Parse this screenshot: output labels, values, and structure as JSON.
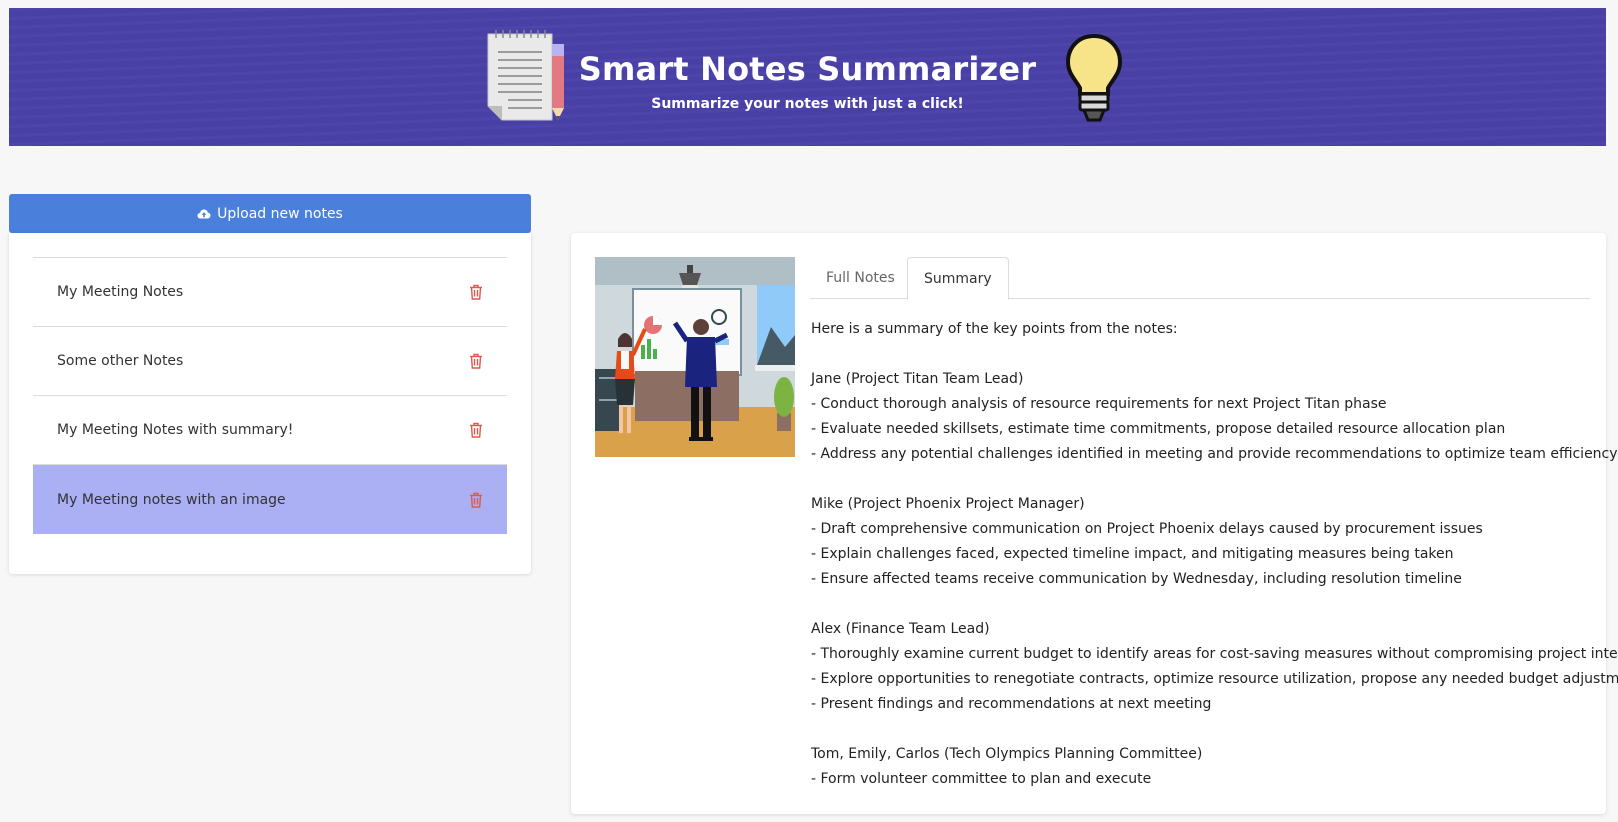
{
  "header": {
    "title": "Smart Notes Summarizer",
    "subtitle": "Summarize your notes with just a click!",
    "colors": {
      "background": "#4a41a8"
    }
  },
  "sidebar": {
    "upload_label": "Upload new notes",
    "upload_icon": "cloud-upload-icon",
    "notes": [
      {
        "title": "My Meeting Notes",
        "active": false
      },
      {
        "title": "Some other Notes",
        "active": false
      },
      {
        "title": "My Meeting Notes with summary!",
        "active": false
      },
      {
        "title": "My Meeting notes with an image",
        "active": true
      }
    ],
    "delete_icon": "trash-icon",
    "colors": {
      "button": "#4a7fdb",
      "active_item": "#abaff4",
      "delete": "#e0584b"
    }
  },
  "detail": {
    "tabs": [
      {
        "label": "Full Notes",
        "active": false
      },
      {
        "label": "Summary",
        "active": true
      }
    ],
    "summary_lines": [
      "Here is a summary of the key points from the notes:",
      "",
      "Jane (Project Titan Team Lead)",
      "- Conduct thorough analysis of resource requirements for next Project Titan phase",
      "- Evaluate needed skillsets, estimate time commitments, propose detailed resource allocation plan",
      "- Address any potential challenges identified in meeting and provide recommendations to optimize team efficiency",
      "",
      "Mike (Project Phoenix Project Manager)",
      "- Draft comprehensive communication on Project Phoenix delays caused by procurement issues",
      "- Explain challenges faced, expected timeline impact, and mitigating measures being taken",
      "- Ensure affected teams receive communication by Wednesday, including resolution timeline",
      "",
      "Alex (Finance Team Lead)",
      "- Thoroughly examine current budget to identify areas for cost-saving measures without compromising project integrity",
      "- Explore opportunities to renegotiate contracts, optimize resource utilization, propose any needed budget adjustments",
      "- Present findings and recommendations at next meeting",
      "",
      "Tom, Emily, Carlos (Tech Olympics Planning Committee)",
      "- Form volunteer committee to plan and execute"
    ]
  }
}
